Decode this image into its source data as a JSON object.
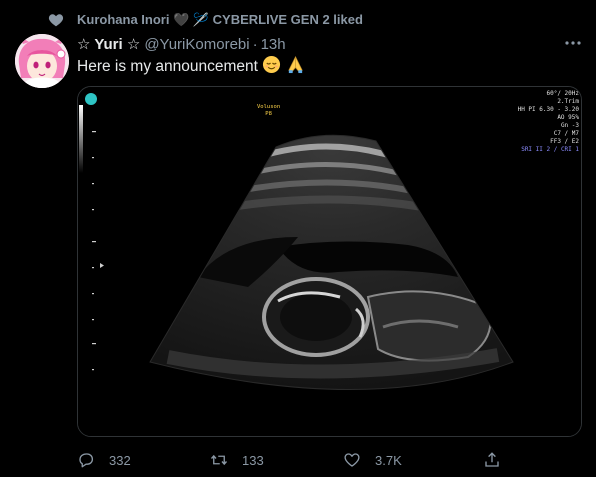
{
  "liked_row": {
    "text": "Kurohana Inori 🖤 🪡 CYBERLIVE GEN 2 liked",
    "icon": "heart-icon"
  },
  "tweet": {
    "display_name": "☆ Yuri ☆",
    "handle": "@YuriKomorebi",
    "separator": "·",
    "time": "13h",
    "text": "Here is my announcement",
    "emojis": [
      "relieved-face-emoji",
      "folded-hands-emoji"
    ]
  },
  "ultrasound": {
    "top_label_1": "Voluson",
    "top_label_2": "P8",
    "settings": [
      "60°/ 20Hz",
      "2.Trim",
      "HH PI 6.30 - 3.20",
      "AO 95%",
      "Gn -3",
      "C7 / M7",
      "FF3 / E2"
    ],
    "settings_highlight": "SRI II 2 / CRI 1"
  },
  "actions": {
    "reply_count": "332",
    "retweet_count": "133",
    "like_count": "3.7K"
  },
  "colors": {
    "background": "#000000",
    "muted_text": "#8b98a5",
    "primary_text": "#e7e9ea",
    "border": "#2f3336"
  }
}
